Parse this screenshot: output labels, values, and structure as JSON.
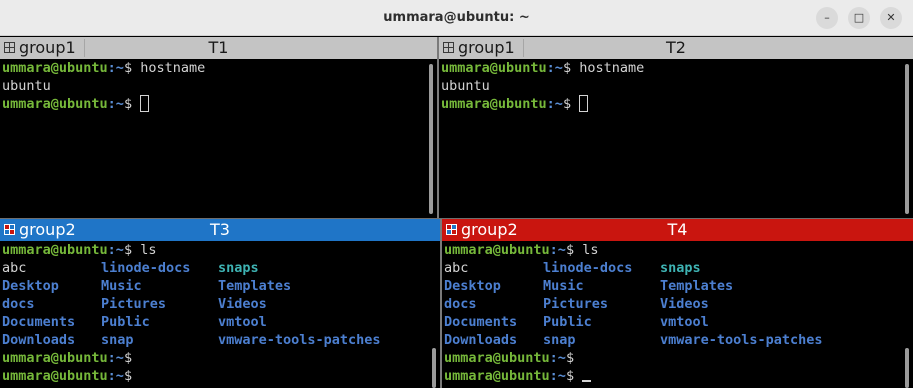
{
  "window": {
    "title": "ummara@ubuntu: ~",
    "min_glyph": "–",
    "max_glyph": "□",
    "close_glyph": "✕"
  },
  "colors": {
    "active_blue": "#1f75c7",
    "active_red": "#c9150f",
    "inactive": "#c4c4c4",
    "prompt_green": "#76b83a",
    "dir_blue": "#4c7fd0"
  },
  "panes": [
    {
      "group": "group1",
      "name": "T1",
      "state": "inactive",
      "lines": [
        {
          "user": "ummara@ubuntu",
          "path": ":~",
          "cmd": "$ hostname"
        },
        {
          "text": "ubuntu"
        },
        {
          "user": "ummara@ubuntu",
          "path": ":~",
          "cmd": "$ "
        }
      ]
    },
    {
      "group": "group1",
      "name": "T2",
      "state": "inactive",
      "lines": [
        {
          "user": "ummara@ubuntu",
          "path": ":~",
          "cmd": "$ hostname"
        },
        {
          "text": "ubuntu"
        },
        {
          "user": "ummara@ubuntu",
          "path": ":~",
          "cmd": "$ "
        }
      ]
    },
    {
      "group": "group2",
      "name": "T3",
      "state": "active-blue",
      "cmd_line": {
        "user": "ummara@ubuntu",
        "path": ":~",
        "cmd": "$ ls"
      },
      "ls": [
        [
          "abc",
          "linode-docs",
          "snaps"
        ],
        [
          "Desktop",
          "Music",
          "Templates"
        ],
        [
          "docs",
          "Pictures",
          "Videos"
        ],
        [
          "Documents",
          "Public",
          "vmtool"
        ],
        [
          "Downloads",
          "snap",
          "vmware-tools-patches"
        ]
      ],
      "after": [
        {
          "user": "ummara@ubuntu",
          "path": ":~",
          "cmd": "$"
        },
        {
          "user": "ummara@ubuntu",
          "path": ":~",
          "cmd": "$"
        }
      ]
    },
    {
      "group": "group2",
      "name": "T4",
      "state": "active-red",
      "cmd_line": {
        "user": "ummara@ubuntu",
        "path": ":~",
        "cmd": "$ ls"
      },
      "ls": [
        [
          "abc",
          "linode-docs",
          "snaps"
        ],
        [
          "Desktop",
          "Music",
          "Templates"
        ],
        [
          "docs",
          "Pictures",
          "Videos"
        ],
        [
          "Documents",
          "Public",
          "vmtool"
        ],
        [
          "Downloads",
          "snap",
          "vmware-tools-patches"
        ]
      ],
      "after": [
        {
          "user": "ummara@ubuntu",
          "path": ":~",
          "cmd": "$"
        },
        {
          "user": "ummara@ubuntu",
          "path": ":~",
          "cmd": "$ "
        }
      ]
    }
  ]
}
